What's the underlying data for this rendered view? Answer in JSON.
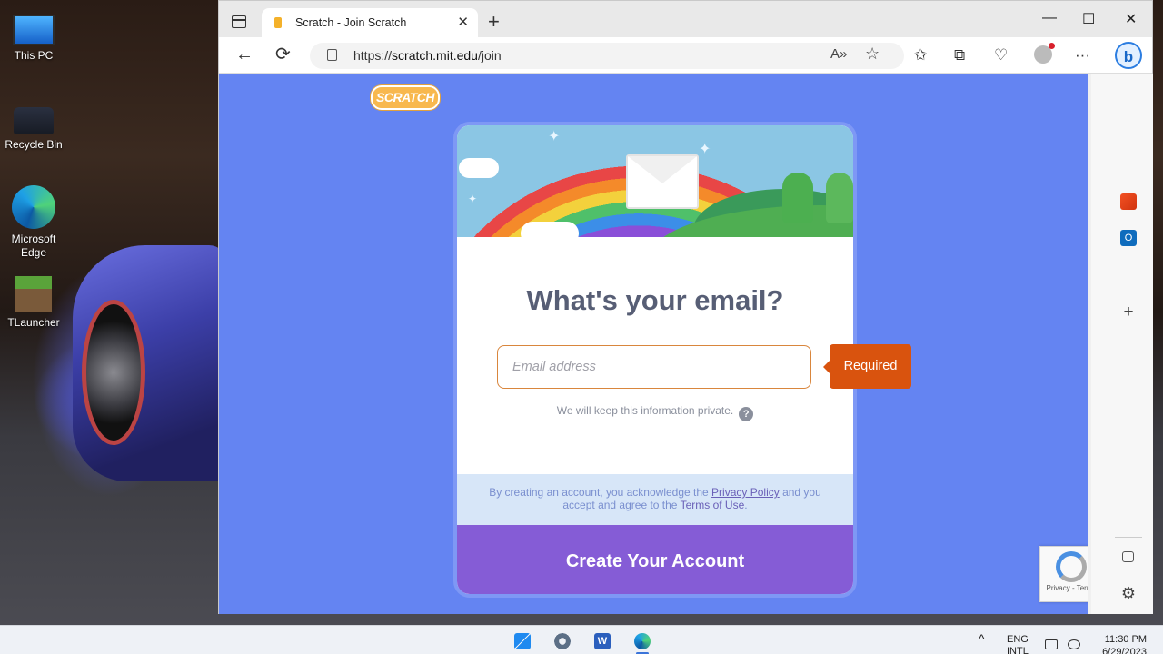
{
  "desktop": {
    "icons": [
      {
        "label": "This PC",
        "icon": "computer-icon"
      },
      {
        "label": "Recycle Bin",
        "icon": "recycle-bin-icon"
      },
      {
        "label": "Microsoft Edge",
        "icon": "edge-icon"
      },
      {
        "label": "TLauncher",
        "icon": "minecraft-block-icon"
      }
    ]
  },
  "browser": {
    "tab": {
      "title": "Scratch - Join Scratch",
      "close": "✕"
    },
    "new_tab": "+",
    "window_controls": {
      "minimize": "—",
      "maximize": "☐",
      "close": "✕"
    },
    "nav": {
      "back": "←",
      "refresh": "⟳"
    },
    "url": {
      "scheme": "https://",
      "host": "scratch.mit.edu",
      "path": "/join"
    },
    "toolbar_icons": {
      "read_aloud": "A»",
      "favorite": "☆",
      "favorites": "✩",
      "collections": "⧉",
      "performance": "♡",
      "more": "···",
      "bing": "b"
    }
  },
  "page": {
    "logo_text": "SCRATCH",
    "heading": "What's your email?",
    "email_placeholder": "Email address",
    "required_tooltip": "Required",
    "privacy_note": "We will keep this information private.",
    "help_icon": "?",
    "terms": {
      "prefix": "By creating an account, you acknowledge the",
      "privacy_link": "Privacy Policy",
      "middle": "and you accept and agree to the",
      "terms_link": "Terms of Use",
      "suffix": "."
    },
    "create_button": "Create Your Account",
    "recaptcha_links": "Privacy - Terms"
  },
  "sidebar": {
    "add": "+",
    "settings": "⚙"
  },
  "taskbar": {
    "tray_chevron": "^",
    "language": "ENG",
    "language_sub": "INTL",
    "time": "11:30 PM",
    "date": "6/29/2023"
  },
  "colors": {
    "page_bg": "#6484f2",
    "primary": "#855cd6",
    "heading": "#575e75",
    "required": "#d9530e",
    "terms_bg": "#d7e6f8"
  }
}
